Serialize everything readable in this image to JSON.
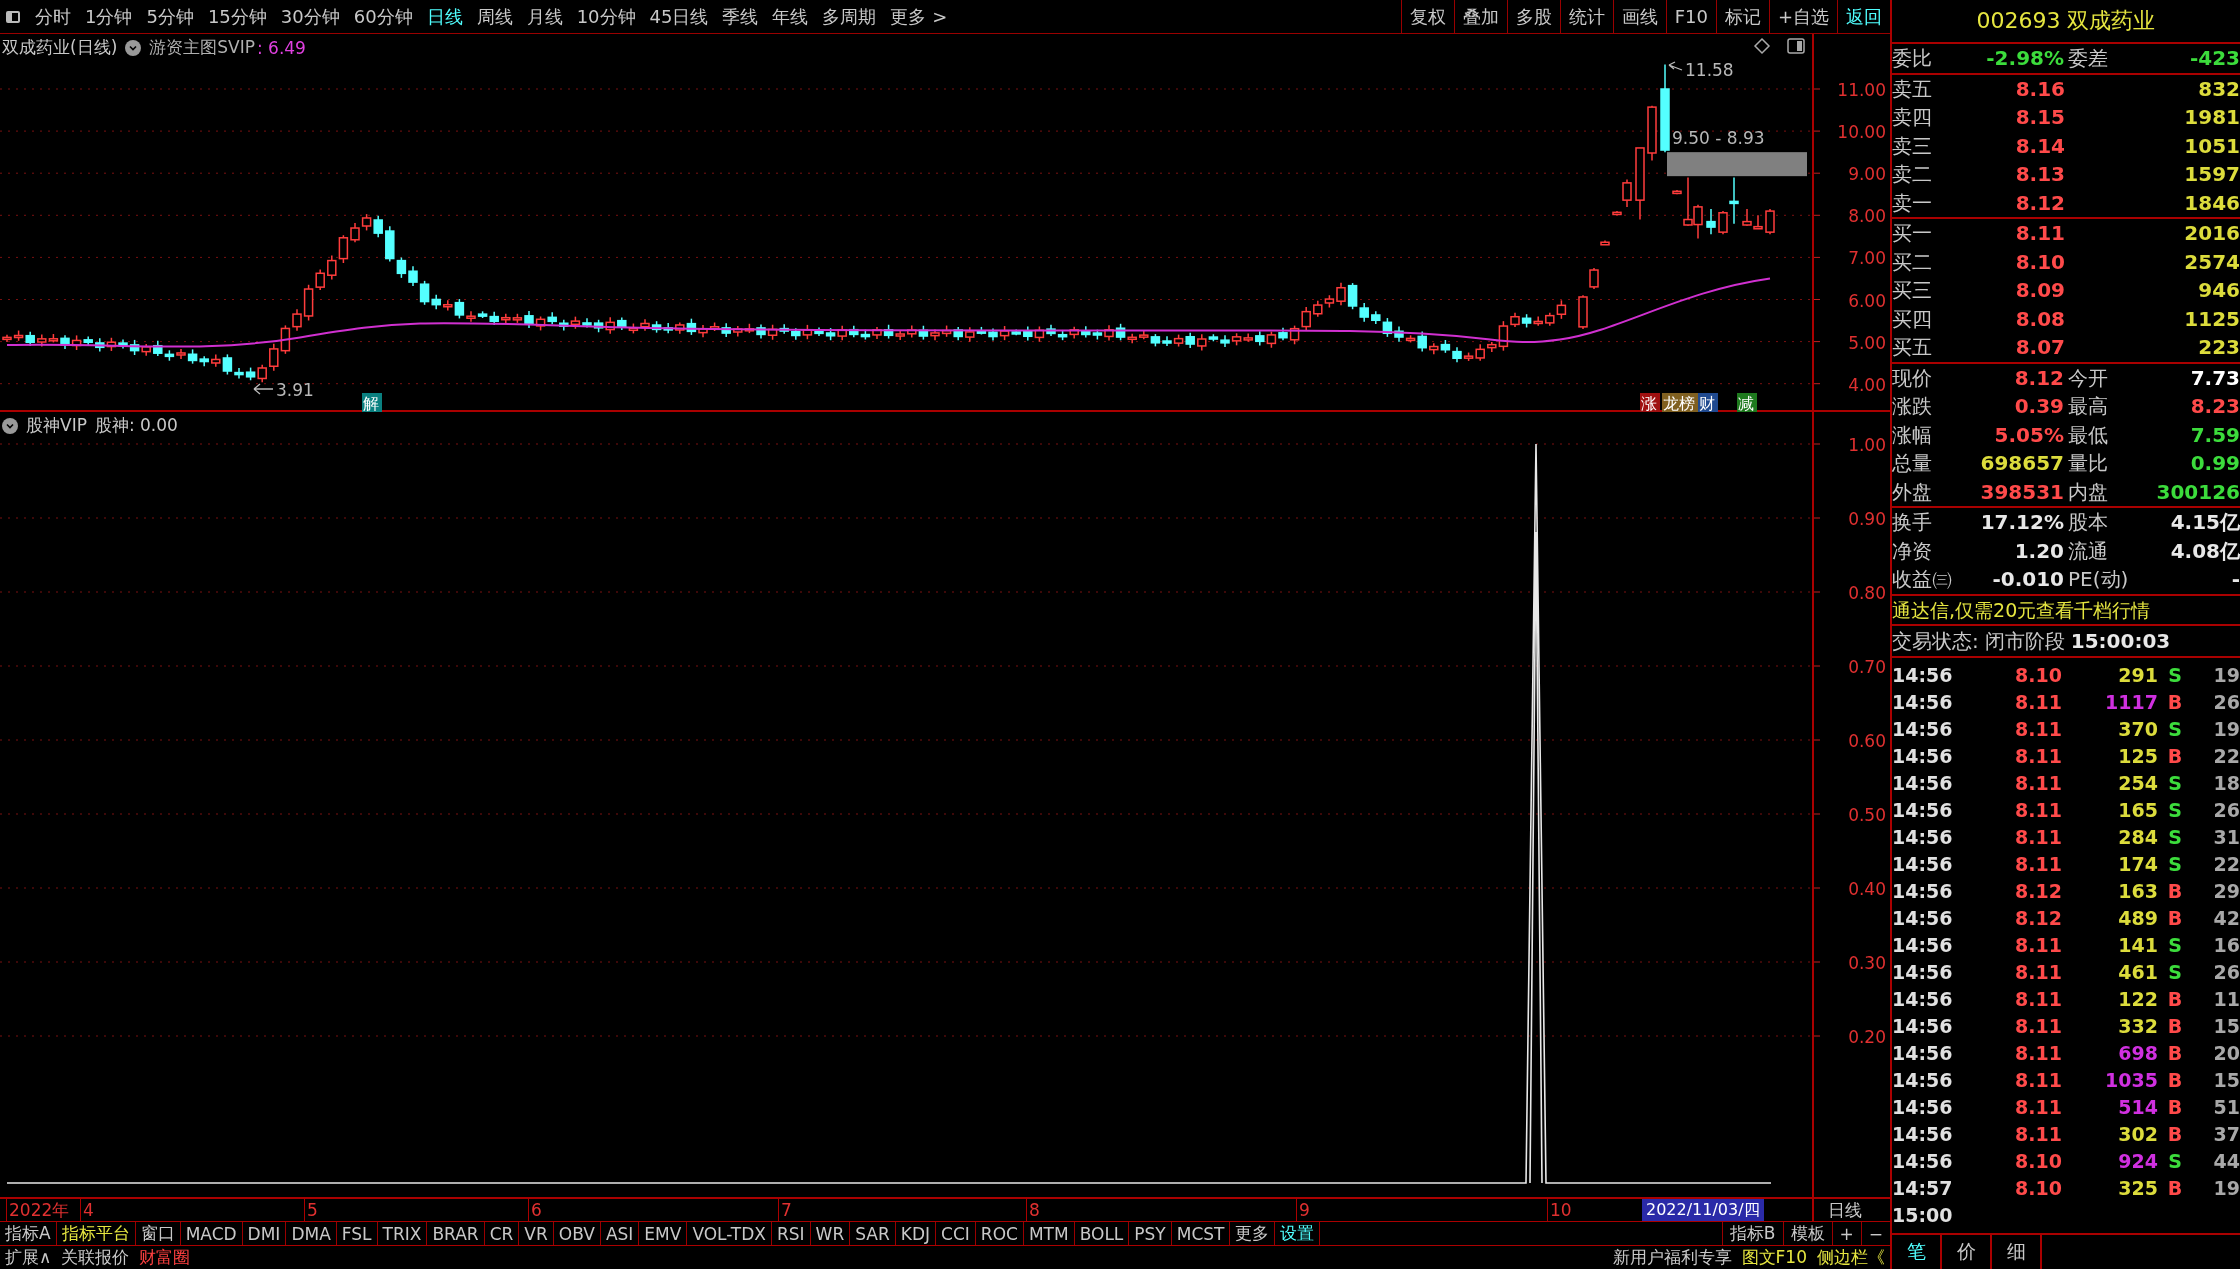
{
  "toolbar": {
    "periods": [
      {
        "label": "分时",
        "selected": false
      },
      {
        "label": "1分钟",
        "selected": false
      },
      {
        "label": "5分钟",
        "selected": false
      },
      {
        "label": "15分钟",
        "selected": false
      },
      {
        "label": "30分钟",
        "selected": false
      },
      {
        "label": "60分钟",
        "selected": false
      },
      {
        "label": "日线",
        "selected": true
      },
      {
        "label": "周线",
        "selected": false
      },
      {
        "label": "月线",
        "selected": false
      },
      {
        "label": "10分钟",
        "selected": false
      },
      {
        "label": "45日线",
        "selected": false
      },
      {
        "label": "季线",
        "selected": false
      },
      {
        "label": "年线",
        "selected": false
      },
      {
        "label": "多周期",
        "selected": false
      },
      {
        "label": "更多 >",
        "selected": false
      }
    ],
    "actions": [
      {
        "label": "复权",
        "kind": "plain"
      },
      {
        "label": "叠加",
        "kind": "plain"
      },
      {
        "label": "多股",
        "kind": "plain"
      },
      {
        "label": "统计",
        "kind": "plain"
      },
      {
        "label": "画线",
        "kind": "plain"
      },
      {
        "label": "F10",
        "kind": "plain"
      },
      {
        "label": "标记",
        "kind": "plain"
      },
      {
        "label": "+自选",
        "kind": "plain"
      },
      {
        "label": "返回",
        "kind": "accent"
      }
    ]
  },
  "price_pane": {
    "title": "双成药业(日线)",
    "indicator": "游资主图SVIP",
    "value": ": 6.49",
    "axis_labels": [
      "11.00",
      "10.00",
      "9.00",
      "8.00",
      "7.00",
      "6.00",
      "5.00",
      "4.00"
    ],
    "high_label": "11.58",
    "low_label": "3.91",
    "zone_label": "9.50 - 8.93",
    "event_tags": [
      {
        "label": "解",
        "color": "#0a8080"
      },
      {
        "label": "涨",
        "color": "#a01010"
      },
      {
        "label": "龙榜",
        "color": "#806020"
      },
      {
        "label": "财",
        "color": "#204a90"
      },
      {
        "label": "减",
        "color": "#1e7a1e"
      }
    ]
  },
  "indicator_pane": {
    "title": "股神VIP",
    "reading": "股神: 0.00",
    "axis_labels": [
      "1.00",
      "0.90",
      "0.80",
      "0.70",
      "0.60",
      "0.50",
      "0.40",
      "0.30",
      "0.20"
    ]
  },
  "date_axis": {
    "labels": [
      "2022年",
      "4",
      "5",
      "6",
      "7",
      "8",
      "9",
      "10"
    ],
    "current_date": "2022/11/03/四",
    "period": "日线"
  },
  "indicator_tabs": {
    "left": [
      {
        "label": "指标A",
        "kind": "plain"
      },
      {
        "label": "指标平台",
        "kind": "featured"
      },
      {
        "label": "窗口",
        "kind": "plain"
      },
      {
        "label": "MACD",
        "kind": "plain"
      },
      {
        "label": "DMI",
        "kind": "plain"
      },
      {
        "label": "DMA",
        "kind": "plain"
      },
      {
        "label": "FSL",
        "kind": "plain"
      },
      {
        "label": "TRIX",
        "kind": "plain"
      },
      {
        "label": "BRAR",
        "kind": "plain"
      },
      {
        "label": "CR",
        "kind": "plain"
      },
      {
        "label": "VR",
        "kind": "plain"
      },
      {
        "label": "OBV",
        "kind": "plain"
      },
      {
        "label": "ASI",
        "kind": "plain"
      },
      {
        "label": "EMV",
        "kind": "plain"
      },
      {
        "label": "VOL-TDX",
        "kind": "plain"
      },
      {
        "label": "RSI",
        "kind": "plain"
      },
      {
        "label": "WR",
        "kind": "plain"
      },
      {
        "label": "SAR",
        "kind": "plain"
      },
      {
        "label": "KDJ",
        "kind": "plain"
      },
      {
        "label": "CCI",
        "kind": "plain"
      },
      {
        "label": "ROC",
        "kind": "plain"
      },
      {
        "label": "MTM",
        "kind": "plain"
      },
      {
        "label": "BOLL",
        "kind": "plain"
      },
      {
        "label": "PSY",
        "kind": "plain"
      },
      {
        "label": "MCST",
        "kind": "plain"
      },
      {
        "label": "更多",
        "kind": "plain"
      },
      {
        "label": "设置",
        "kind": "settings"
      }
    ],
    "right": [
      {
        "label": "指标B",
        "kind": "plain"
      },
      {
        "label": "模板",
        "kind": "plain"
      },
      {
        "label": "+",
        "kind": "plain"
      },
      {
        "label": "−",
        "kind": "plain"
      }
    ]
  },
  "bottom_bar": {
    "left": [
      {
        "label": "扩展∧",
        "kind": "plain"
      },
      {
        "label": "关联报价",
        "kind": "plain"
      },
      {
        "label": "财富圈",
        "kind": "alert"
      }
    ],
    "right": [
      {
        "label": "新用户福利专享",
        "kind": "plain"
      },
      {
        "label": "图文F10",
        "kind": "featured"
      },
      {
        "label": "侧边栏《",
        "kind": "featured"
      }
    ]
  },
  "quote_panel": {
    "code": "002693",
    "name": "双成药业",
    "ratio": {
      "label": "委比",
      "value": "-2.98%",
      "diff_label": "委差",
      "diff_value": "-423"
    },
    "asks": [
      {
        "label": "卖五",
        "price": "8.16",
        "volume": "832"
      },
      {
        "label": "卖四",
        "price": "8.15",
        "volume": "1981"
      },
      {
        "label": "卖三",
        "price": "8.14",
        "volume": "1051"
      },
      {
        "label": "卖二",
        "price": "8.13",
        "volume": "1597"
      },
      {
        "label": "卖一",
        "price": "8.12",
        "volume": "1846"
      }
    ],
    "bids": [
      {
        "label": "买一",
        "price": "8.11",
        "volume": "2016"
      },
      {
        "label": "买二",
        "price": "8.10",
        "volume": "2574"
      },
      {
        "label": "买三",
        "price": "8.09",
        "volume": "946"
      },
      {
        "label": "买四",
        "price": "8.08",
        "volume": "1125"
      },
      {
        "label": "买五",
        "price": "8.07",
        "volume": "223"
      }
    ],
    "stats": [
      {
        "label": "现价",
        "value": "8.12",
        "color": "#ff4a4a"
      },
      {
        "label": "今开",
        "value": "7.73",
        "color": "#ffffff"
      },
      {
        "label": "涨跌",
        "value": "0.39",
        "color": "#ff4a4a"
      },
      {
        "label": "最高",
        "value": "8.23",
        "color": "#ff4a4a"
      },
      {
        "label": "涨幅",
        "value": "5.05%",
        "color": "#ff4a4a"
      },
      {
        "label": "最低",
        "value": "7.59",
        "color": "#3cdc3c"
      },
      {
        "label": "总量",
        "value": "698657",
        "color": "#dcdc3c"
      },
      {
        "label": "量比",
        "value": "0.99",
        "color": "#3cdc3c"
      },
      {
        "label": "外盘",
        "value": "398531",
        "color": "#ff4a4a"
      },
      {
        "label": "内盘",
        "value": "300126",
        "color": "#3cdc3c"
      }
    ],
    "fundamentals": [
      {
        "label": "换手",
        "value": "17.12%"
      },
      {
        "label": "股本",
        "value": "4.15亿"
      },
      {
        "label": "净资",
        "value": "1.20"
      },
      {
        "label": "流通",
        "value": "4.08亿"
      },
      {
        "label": "收益㈢",
        "value": "-0.010"
      },
      {
        "label": "PE(动)",
        "value": "-"
      }
    ],
    "ad": "通达信,仅需20元查看千档行情",
    "status_label": "交易状态:",
    "status": "闭市阶段",
    "status_time": "15:00:03",
    "ticks": [
      {
        "time": "14:56",
        "price": "8.10",
        "volume": "291",
        "large": false,
        "side": "S",
        "buy": false,
        "count": "19"
      },
      {
        "time": "14:56",
        "price": "8.11",
        "volume": "1117",
        "large": true,
        "side": "B",
        "buy": true,
        "count": "26"
      },
      {
        "time": "14:56",
        "price": "8.11",
        "volume": "370",
        "large": false,
        "side": "S",
        "buy": false,
        "count": "19"
      },
      {
        "time": "14:56",
        "price": "8.11",
        "volume": "125",
        "large": false,
        "side": "B",
        "buy": true,
        "count": "22"
      },
      {
        "time": "14:56",
        "price": "8.11",
        "volume": "254",
        "large": false,
        "side": "S",
        "buy": false,
        "count": "18"
      },
      {
        "time": "14:56",
        "price": "8.11",
        "volume": "165",
        "large": false,
        "side": "S",
        "buy": false,
        "count": "26"
      },
      {
        "time": "14:56",
        "price": "8.11",
        "volume": "284",
        "large": false,
        "side": "S",
        "buy": false,
        "count": "31"
      },
      {
        "time": "14:56",
        "price": "8.11",
        "volume": "174",
        "large": false,
        "side": "S",
        "buy": false,
        "count": "22"
      },
      {
        "time": "14:56",
        "price": "8.12",
        "volume": "163",
        "large": false,
        "side": "B",
        "buy": true,
        "count": "29"
      },
      {
        "time": "14:56",
        "price": "8.12",
        "volume": "489",
        "large": false,
        "side": "B",
        "buy": true,
        "count": "42"
      },
      {
        "time": "14:56",
        "price": "8.11",
        "volume": "141",
        "large": false,
        "side": "S",
        "buy": false,
        "count": "16"
      },
      {
        "time": "14:56",
        "price": "8.11",
        "volume": "461",
        "large": false,
        "side": "S",
        "buy": false,
        "count": "26"
      },
      {
        "time": "14:56",
        "price": "8.11",
        "volume": "122",
        "large": false,
        "side": "B",
        "buy": true,
        "count": "11"
      },
      {
        "time": "14:56",
        "price": "8.11",
        "volume": "332",
        "large": false,
        "side": "B",
        "buy": true,
        "count": "15"
      },
      {
        "time": "14:56",
        "price": "8.11",
        "volume": "698",
        "large": true,
        "side": "B",
        "buy": true,
        "count": "20"
      },
      {
        "time": "14:56",
        "price": "8.11",
        "volume": "1035",
        "large": true,
        "side": "B",
        "buy": true,
        "count": "15"
      },
      {
        "time": "14:56",
        "price": "8.11",
        "volume": "514",
        "large": true,
        "side": "B",
        "buy": true,
        "count": "51"
      },
      {
        "time": "14:56",
        "price": "8.11",
        "volume": "302",
        "large": false,
        "side": "B",
        "buy": true,
        "count": "37"
      },
      {
        "time": "14:56",
        "price": "8.10",
        "volume": "924",
        "large": true,
        "side": "S",
        "buy": false,
        "count": "44"
      },
      {
        "time": "14:57",
        "price": "8.10",
        "volume": "325",
        "large": false,
        "side": "B",
        "buy": true,
        "count": "19"
      },
      {
        "time": "15:00"
      }
    ],
    "tabs": [
      {
        "label": "笔",
        "selected": true
      },
      {
        "label": "价",
        "selected": false
      },
      {
        "label": "细",
        "selected": false
      }
    ]
  }
}
